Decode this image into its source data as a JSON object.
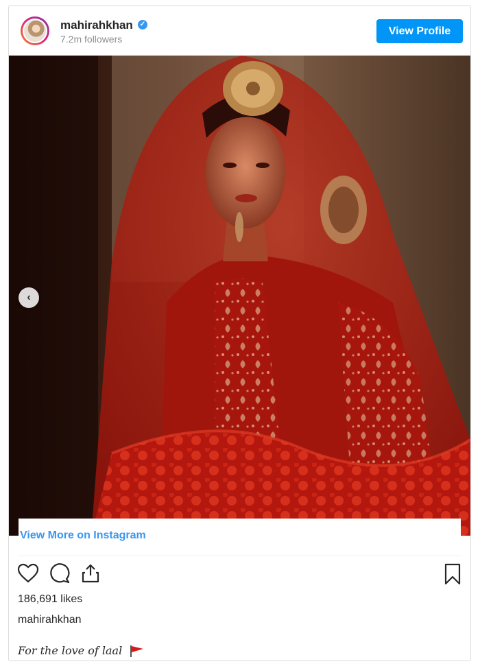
{
  "post": {
    "username": "mahirahkhan",
    "followers": "7.2m followers",
    "view_profile_label": "View Profile",
    "view_more_label": "View More on Instagram",
    "likes": "186,691 likes",
    "caption_user": "mahirahkhan",
    "caption_text": "For the love of laal"
  },
  "icons": {
    "verified": "verified-badge-icon",
    "prev": "chevron-left-icon",
    "like": "heart-icon",
    "comment": "comment-icon",
    "share": "share-icon",
    "save": "bookmark-icon",
    "flag": "red-flag-icon"
  },
  "colors": {
    "brand_blue": "#0095f6",
    "link_blue": "#3897f0",
    "text": "#262626",
    "muted": "#8e8e8e"
  }
}
